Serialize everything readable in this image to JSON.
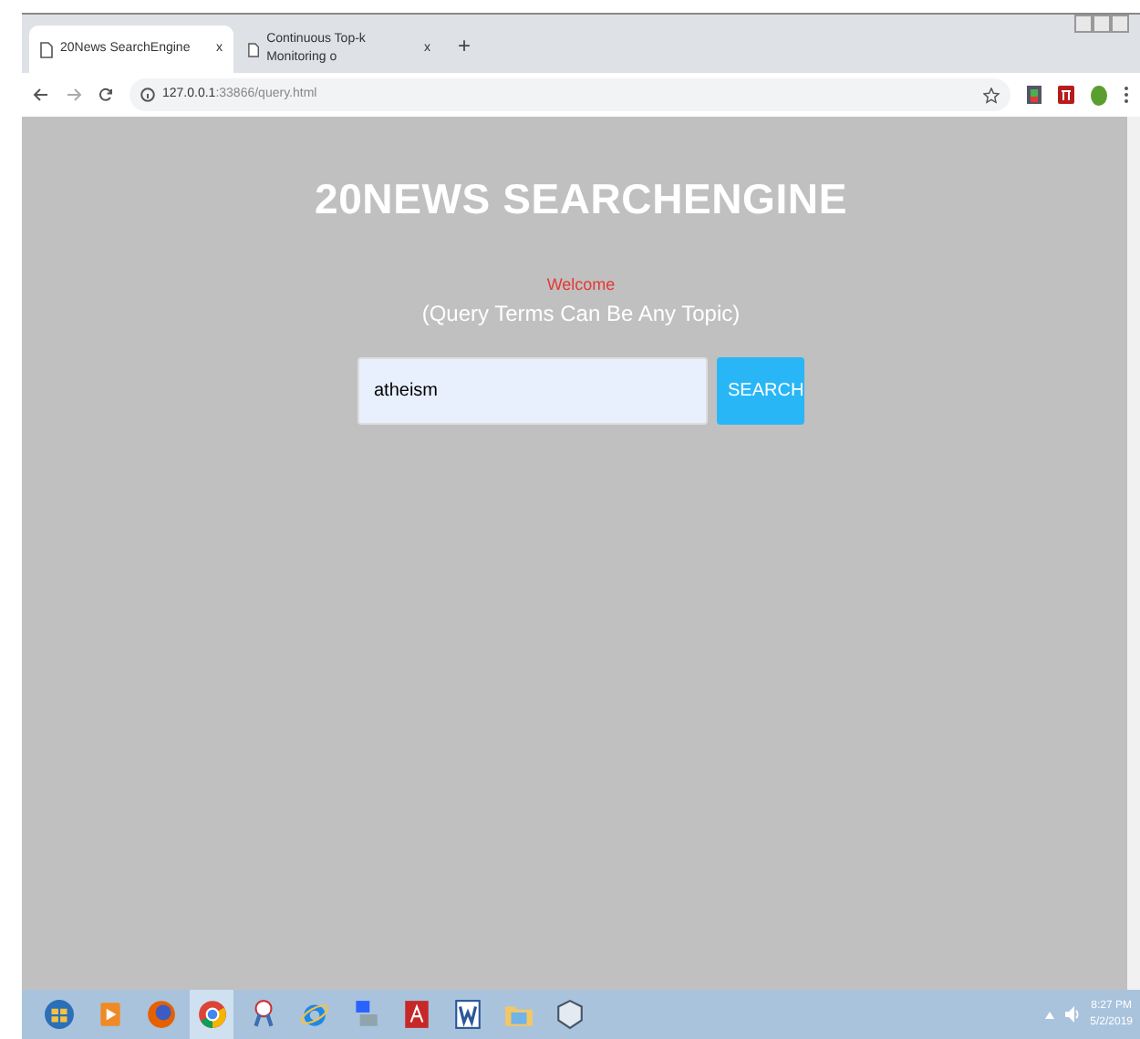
{
  "browser": {
    "tabs": [
      {
        "title": "20News SearchEngine",
        "close": "x",
        "selected": true
      },
      {
        "title": "Continuous Top-k Monitoring o",
        "close": "x",
        "selected": false
      }
    ],
    "new_tab": "+",
    "address": {
      "host": "127.0.0.1",
      "path": ":33866/query.html"
    }
  },
  "page": {
    "title": "20NEWS SEARCHENGINE",
    "welcome": "Welcome",
    "subtitle": "(Query Terms Can Be Any Topic)",
    "query": "atheism",
    "button": "SEARCH"
  },
  "taskbar": {
    "items": [
      {
        "kind": "start",
        "selected": false
      },
      {
        "kind": "media",
        "selected": false
      },
      {
        "kind": "firefox",
        "selected": false
      },
      {
        "kind": "chrome",
        "selected": true
      },
      {
        "kind": "snip",
        "selected": false
      },
      {
        "kind": "ie",
        "selected": false
      },
      {
        "kind": "network",
        "selected": false
      },
      {
        "kind": "pdf",
        "selected": false
      },
      {
        "kind": "word",
        "selected": false
      },
      {
        "kind": "folder",
        "selected": false
      },
      {
        "kind": "shield",
        "selected": false
      }
    ],
    "time": "8:27 PM",
    "date": "5/2/2019"
  }
}
